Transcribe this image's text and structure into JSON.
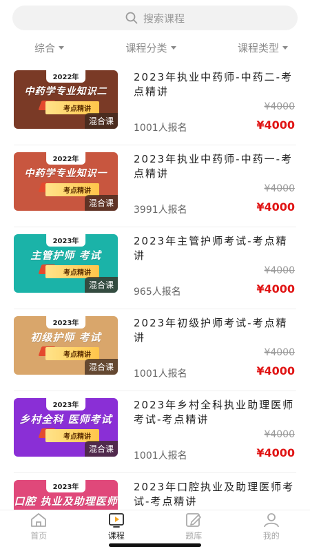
{
  "search": {
    "placeholder": "搜索课程",
    "icon": "search-icon"
  },
  "filters": [
    {
      "label": "综合"
    },
    {
      "label": "课程分类"
    },
    {
      "label": "课程类型"
    }
  ],
  "courses": [
    {
      "title": "2023年执业中药师-中药二-考点精讲",
      "original_price": "¥4000",
      "price": "¥4000",
      "enrolled": "1001人报名",
      "thumb_year": "2022年",
      "thumb_subject": "中药学专业知识二",
      "thumb_ribbon": "考点精讲",
      "tag": "混合课",
      "thumb_color": "#7a3a26"
    },
    {
      "title": "2023年执业中药师-中药一-考点精讲",
      "original_price": "¥4000",
      "price": "¥4000",
      "enrolled": "3991人报名",
      "thumb_year": "2022年",
      "thumb_subject": "中药学专业知识一",
      "thumb_ribbon": "考点精讲",
      "tag": "混合课",
      "thumb_color": "#c8563f"
    },
    {
      "title": "2023年主管护师考试-考点精讲",
      "original_price": "¥4000",
      "price": "¥4000",
      "enrolled": "965人报名",
      "thumb_year": "2023年",
      "thumb_subject": "主管护师 考试",
      "thumb_ribbon": "考点精讲",
      "tag": "混合课",
      "thumb_color": "#1bb3a8"
    },
    {
      "title": "2023年初级护师考试-考点精讲",
      "original_price": "¥4000",
      "price": "¥4000",
      "enrolled": "1001人报名",
      "thumb_year": "2023年",
      "thumb_subject": "初级护师 考试",
      "thumb_ribbon": "考点精讲",
      "tag": "混合课",
      "thumb_color": "#d9a66b"
    },
    {
      "title": "2023年乡村全科执业助理医师考试-考点精讲",
      "original_price": "¥4000",
      "price": "¥4000",
      "enrolled": "1001人报名",
      "thumb_year": "2023年",
      "thumb_subject": "乡村全科 医师考试",
      "thumb_ribbon": "考点精讲",
      "tag": "混合课",
      "thumb_color": "#8a2fd6"
    },
    {
      "title": "2023年口腔执业及助理医师考试-考点精讲",
      "original_price": "",
      "price": "",
      "enrolled": "",
      "thumb_year": "2023年",
      "thumb_subject": "口腔 执业及助理医师",
      "thumb_ribbon": "",
      "tag": "",
      "thumb_color": "#e0487a"
    }
  ],
  "tabbar": [
    {
      "label": "首页",
      "icon": "home-icon",
      "active": false
    },
    {
      "label": "课程",
      "icon": "course-play-icon",
      "active": true
    },
    {
      "label": "题库",
      "icon": "edit-question-bank-icon",
      "active": false
    },
    {
      "label": "我的",
      "icon": "user-icon",
      "active": false
    }
  ],
  "colors": {
    "accent_red": "#e01515",
    "active_tab_icon": "#f5a623"
  }
}
